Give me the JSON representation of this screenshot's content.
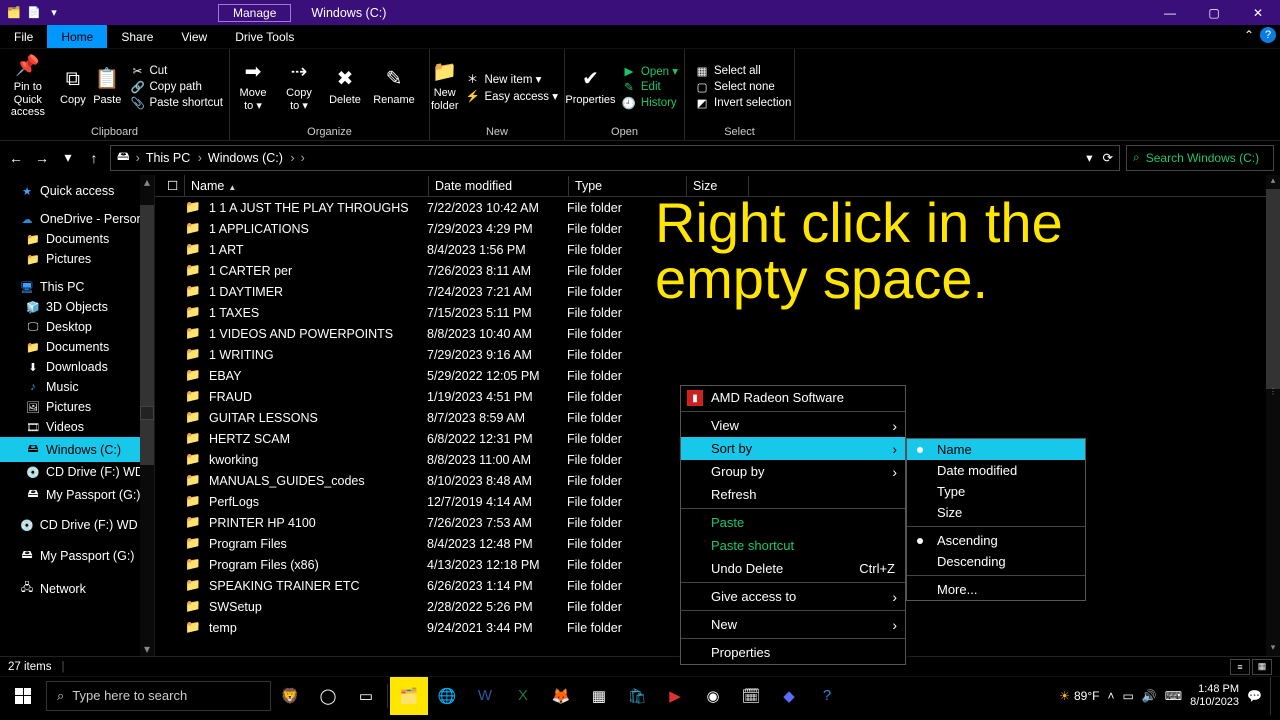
{
  "window": {
    "contextual_tab": "Manage",
    "title": "Windows (C:)",
    "min": "—",
    "max": "▢",
    "close": "✕"
  },
  "menutabs": {
    "file": "File",
    "home": "Home",
    "share": "Share",
    "view": "View",
    "drive": "Drive Tools",
    "collapse": "⌃",
    "help": "?"
  },
  "ribbon": {
    "clipboard": {
      "label": "Clipboard",
      "pin": "Pin to Quick\naccess",
      "copy": "Copy",
      "paste": "Paste",
      "cut": "Cut",
      "copypath": "Copy path",
      "pasteshortcut": "Paste shortcut"
    },
    "organize": {
      "label": "Organize",
      "moveto": "Move\nto ▾",
      "copyto": "Copy\nto ▾",
      "delete": "Delete",
      "rename": "Rename"
    },
    "new": {
      "label": "New",
      "newfolder": "New\nfolder",
      "newitem": "New item ▾",
      "easyaccess": "Easy access ▾"
    },
    "open": {
      "label": "Open",
      "properties": "Properties",
      "open": "Open ▾",
      "edit": "Edit",
      "history": "History"
    },
    "select": {
      "label": "Select",
      "selectall": "Select all",
      "selectnone": "Select none",
      "invert": "Invert selection"
    }
  },
  "nav": {
    "back": "←",
    "fwd": "→",
    "down": "▾",
    "up": "↑",
    "crumb1": "This PC",
    "crumb2": "Windows (C:)",
    "refresh": "⟳",
    "dropdown": "▾",
    "search_placeholder": "Search Windows (C:)",
    "search_icon": "⌕"
  },
  "sidebar": {
    "quick": "Quick access",
    "onedrive": "OneDrive - Person",
    "docs1": "Documents",
    "pics1": "Pictures",
    "thispc": "This PC",
    "objects3d": "3D Objects",
    "desktop": "Desktop",
    "docs2": "Documents",
    "downloads": "Downloads",
    "music": "Music",
    "pics2": "Pictures",
    "videos": "Videos",
    "windowsc": "Windows (C:)",
    "cdf": "CD Drive (F:) WD",
    "passportg": "My Passport (G:)",
    "cdf2": "CD Drive (F:) WD U",
    "passportg2": "My Passport (G:)",
    "network": "Network"
  },
  "columns": {
    "name": "Name",
    "date": "Date modified",
    "type": "Type",
    "size": "Size",
    "sort": "▲"
  },
  "files": [
    {
      "n": "1 1 A JUST THE PLAY THROUGHS",
      "d": "7/22/2023 10:42 AM",
      "t": "File folder"
    },
    {
      "n": "1 APPLICATIONS",
      "d": "7/29/2023 4:29 PM",
      "t": "File folder"
    },
    {
      "n": "1 ART",
      "d": "8/4/2023 1:56 PM",
      "t": "File folder"
    },
    {
      "n": "1 CARTER per",
      "d": "7/26/2023 8:11 AM",
      "t": "File folder"
    },
    {
      "n": "1 DAYTIMER",
      "d": "7/24/2023 7:21 AM",
      "t": "File folder"
    },
    {
      "n": "1 TAXES",
      "d": "7/15/2023 5:11 PM",
      "t": "File folder"
    },
    {
      "n": "1 VIDEOS AND POWERPOINTS",
      "d": "8/8/2023 10:40 AM",
      "t": "File folder"
    },
    {
      "n": "1 WRITING",
      "d": "7/29/2023 9:16 AM",
      "t": "File folder"
    },
    {
      "n": "EBAY",
      "d": "5/29/2022 12:05 PM",
      "t": "File folder"
    },
    {
      "n": "FRAUD",
      "d": "1/19/2023 4:51 PM",
      "t": "File folder"
    },
    {
      "n": "GUITAR LESSONS",
      "d": "8/7/2023 8:59 AM",
      "t": "File folder"
    },
    {
      "n": "HERTZ SCAM",
      "d": "6/8/2022 12:31 PM",
      "t": "File folder"
    },
    {
      "n": "kworking",
      "d": "8/8/2023 11:00 AM",
      "t": "File folder"
    },
    {
      "n": "MANUALS_GUIDES_codes",
      "d": "8/10/2023 8:48 AM",
      "t": "File folder"
    },
    {
      "n": "PerfLogs",
      "d": "12/7/2019 4:14 AM",
      "t": "File folder"
    },
    {
      "n": "PRINTER HP 4100",
      "d": "7/26/2023 7:53 AM",
      "t": "File folder"
    },
    {
      "n": "Program Files",
      "d": "8/4/2023 12:48 PM",
      "t": "File folder"
    },
    {
      "n": "Program Files (x86)",
      "d": "4/13/2023 12:18 PM",
      "t": "File folder"
    },
    {
      "n": "SPEAKING TRAINER ETC",
      "d": "6/26/2023 1:14 PM",
      "t": "File folder"
    },
    {
      "n": "SWSetup",
      "d": "2/28/2022 5:26 PM",
      "t": "File folder"
    },
    {
      "n": "temp",
      "d": "9/24/2021 3:44 PM",
      "t": "File folder"
    }
  ],
  "overlay": {
    "line1": "Right click in the",
    "line2": "empty space."
  },
  "context": {
    "amd": "AMD Radeon Software",
    "view": "View",
    "sortby": "Sort by",
    "groupby": "Group by",
    "refresh": "Refresh",
    "paste": "Paste",
    "pasteshortcut": "Paste shortcut",
    "undo": "Undo Delete",
    "undo_kb": "Ctrl+Z",
    "giveaccess": "Give access to",
    "new": "New",
    "properties": "Properties"
  },
  "submenu": {
    "name": "Name",
    "date": "Date modified",
    "type": "Type",
    "size": "Size",
    "asc": "Ascending",
    "desc": "Descending",
    "more": "More..."
  },
  "status": {
    "count": "27 items"
  },
  "taskbar": {
    "search_placeholder": "Type here to search",
    "temp": "89°F",
    "time": "1:48 PM",
    "date": "8/10/2023"
  }
}
